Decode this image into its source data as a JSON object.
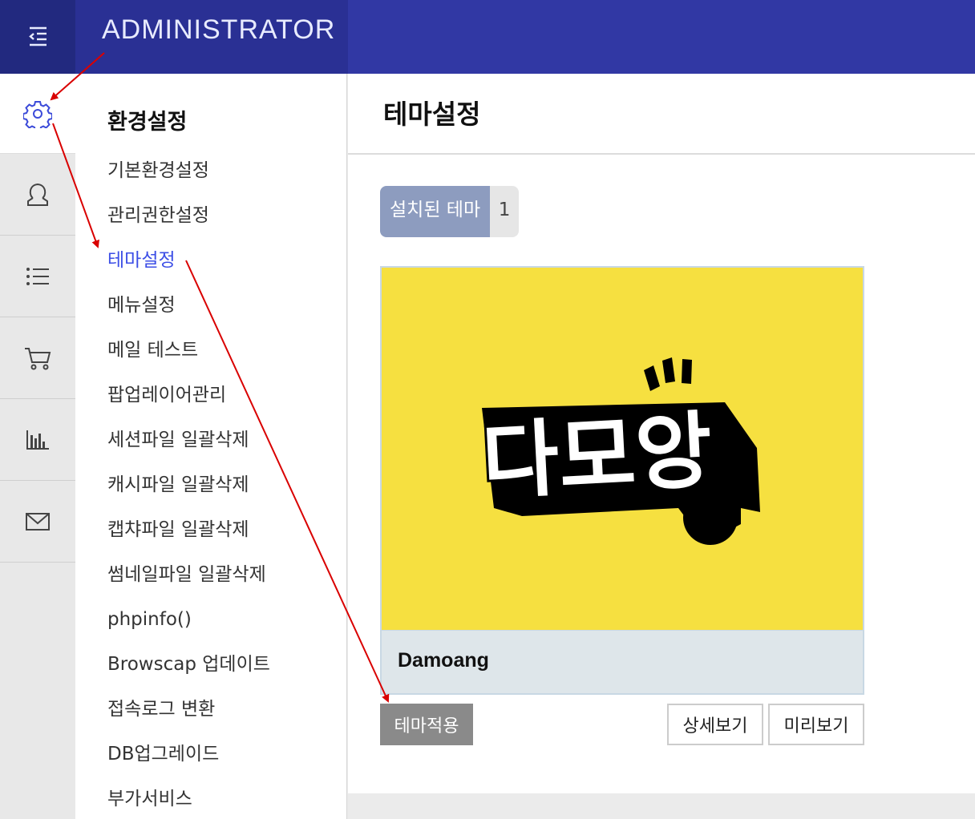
{
  "header": {
    "brand": "ADMINISTRATOR",
    "toggle_icon": "menu-collapse-icon"
  },
  "rail": {
    "items": [
      {
        "icon": "gear-icon",
        "active": true
      },
      {
        "icon": "user-icon",
        "active": false
      },
      {
        "icon": "list-icon",
        "active": false
      },
      {
        "icon": "cart-icon",
        "active": false
      },
      {
        "icon": "bar-chart-icon",
        "active": false
      },
      {
        "icon": "mail-icon",
        "active": false
      }
    ]
  },
  "submenu": {
    "title": "환경설정",
    "items": [
      {
        "label": "기본환경설정"
      },
      {
        "label": "관리권한설정"
      },
      {
        "label": "테마설정",
        "active": true
      },
      {
        "label": "메뉴설정"
      },
      {
        "label": "메일 테스트"
      },
      {
        "label": "팝업레이어관리"
      },
      {
        "label": "세션파일 일괄삭제"
      },
      {
        "label": "캐시파일 일괄삭제"
      },
      {
        "label": "캡챠파일 일괄삭제"
      },
      {
        "label": "썸네일파일 일괄삭제"
      },
      {
        "label": "phpinfo()"
      },
      {
        "label": "Browscap 업데이트"
      },
      {
        "label": "접속로그 변환"
      },
      {
        "label": "DB업그레이드"
      },
      {
        "label": "부가서비스"
      }
    ]
  },
  "main": {
    "title": "테마설정",
    "installed_label": "설치된 테마",
    "installed_count": "1",
    "theme": {
      "logo_text": "다모앙",
      "name": "Damoang"
    },
    "buttons": {
      "apply": "테마적용",
      "detail": "상세보기",
      "preview": "미리보기"
    }
  },
  "colors": {
    "header": "#3138a4",
    "active_link": "#3c4ee6",
    "arrow": "#d90000",
    "theme_bg": "#f6e040"
  }
}
